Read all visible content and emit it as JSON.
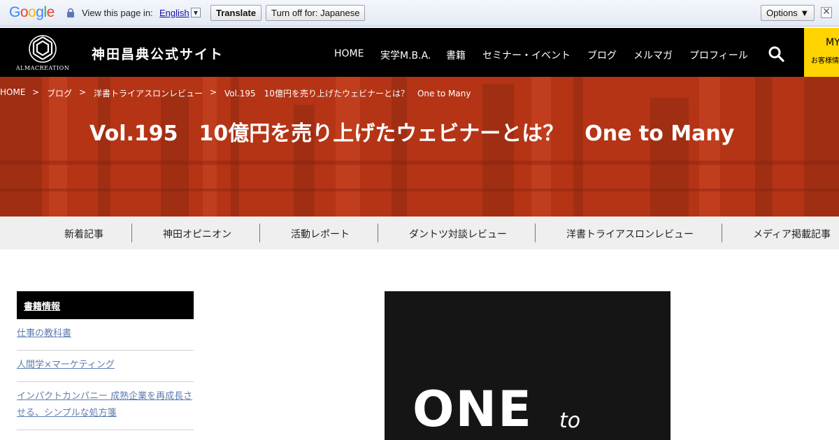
{
  "translate_bar": {
    "logo": "Google",
    "view_text": "View this page in:",
    "language": "English",
    "translate_button": "Translate",
    "turn_off_button": "Turn off for: Japanese",
    "options_button": "Options ▼",
    "close_icon": "✕"
  },
  "header": {
    "logo_text": "ALMACREATION",
    "site_title": "神田昌典公式サイト",
    "nav": [
      "HOME",
      "実学M.B.A.",
      "書籍",
      "セミナー・イベント",
      "ブログ",
      "メルマガ",
      "プロフィール"
    ],
    "my_label": "MY",
    "my_sub": "お客様情報"
  },
  "breadcrumb": [
    "HOME",
    "ブログ",
    "洋書トライアスロンレビュー",
    "Vol.195　10億円を売り上げたウェビナーとは？　One to Many"
  ],
  "breadcrumb_sep": ">",
  "page_title": "Vol.195　10億円を売り上げたウェビナーとは？　One to Many",
  "category_nav": [
    "新着記事",
    "神田オピニオン",
    "活動レポート",
    "ダントツ対談レビュー",
    "洋書トライアスロンレビュー",
    "メディア掲載記事"
  ],
  "sidebar": {
    "heading": "書籍情報",
    "links": [
      "仕事の教科書",
      "人間学×マーケティング",
      "インパクトカンパニー 成熟企業を再成長させる、シンプルな処方箋"
    ]
  },
  "book_cover": {
    "word_one": "ONE",
    "word_to": "to"
  },
  "colors": {
    "hero_red": "#b53416",
    "header_black": "#000000",
    "my_yellow": "#ffd400",
    "link_blue": "#5d7db0"
  }
}
